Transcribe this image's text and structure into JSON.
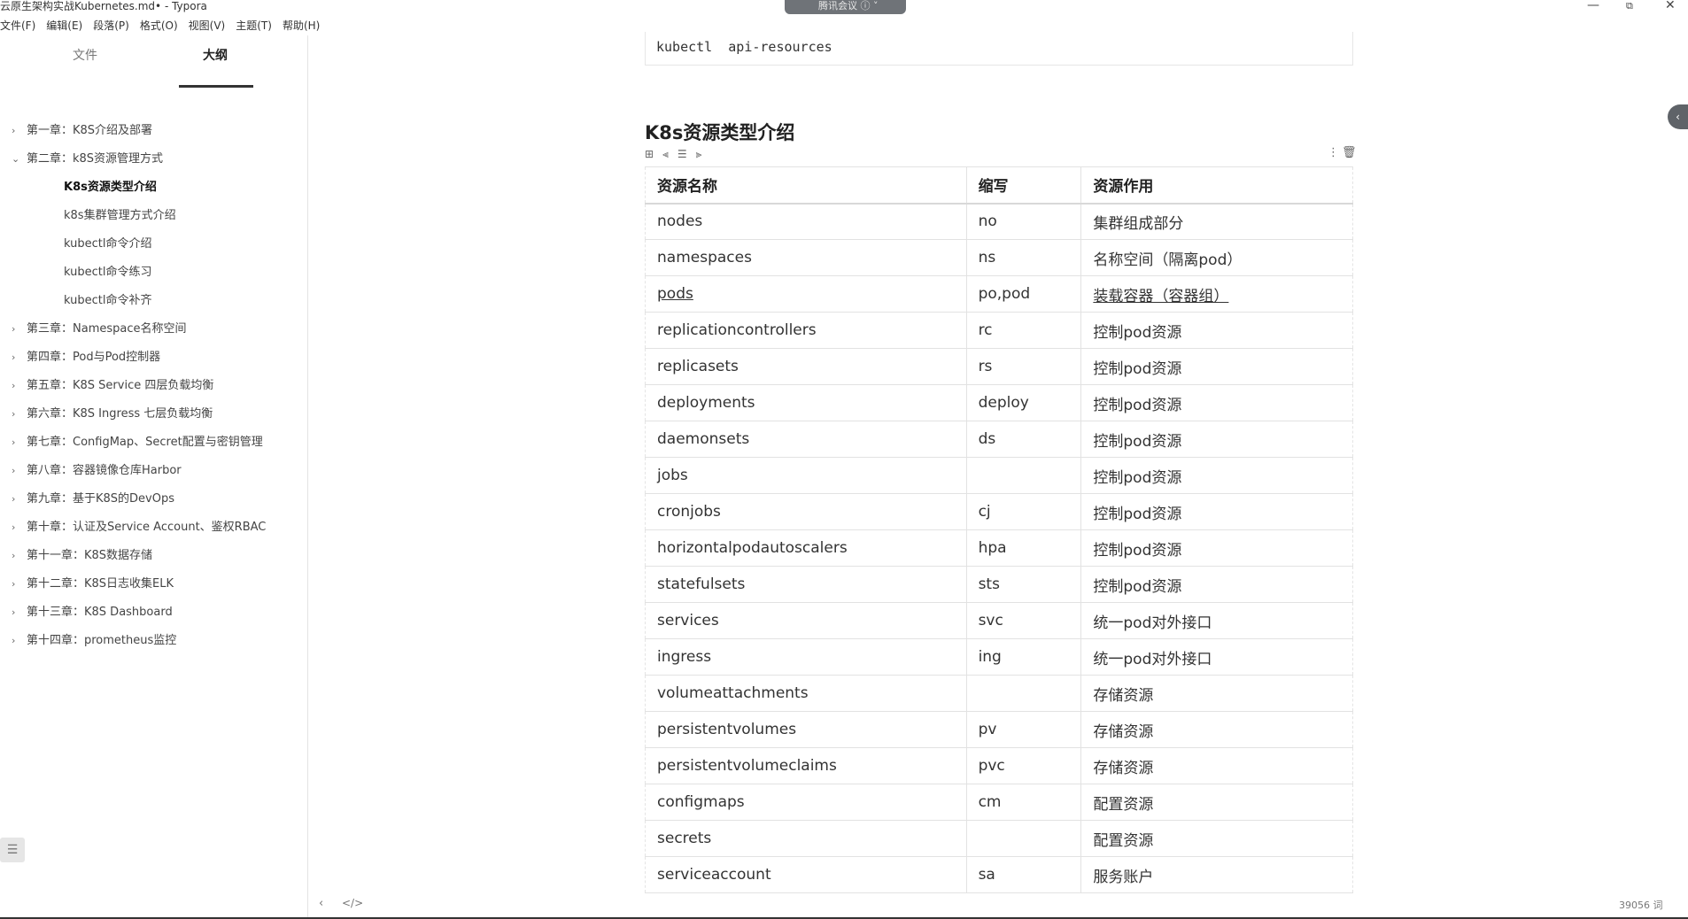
{
  "window": {
    "title": "云原生架构实战Kubernetes.md• - Typora",
    "meeting_label": "腾讯会议 ⓘ ˅",
    "minimize": "—",
    "maximize": "⧉",
    "close": "✕"
  },
  "menu": [
    "文件(F)",
    "编辑(E)",
    "段落(P)",
    "格式(O)",
    "视图(V)",
    "主题(T)",
    "帮助(H)"
  ],
  "sidebar": {
    "tabs": {
      "files": "文件",
      "outline": "大纲"
    },
    "outline": [
      {
        "label": "第一章：K8S介绍及部署",
        "chev": "›"
      },
      {
        "label": "第二章：k8S资源管理方式",
        "chev": "⌄"
      },
      {
        "label": "K8s资源类型介绍",
        "chev": ""
      },
      {
        "label": "k8s集群管理方式介绍",
        "chev": ""
      },
      {
        "label": "kubectl命令介绍",
        "chev": ""
      },
      {
        "label": "kubectl命令练习",
        "chev": ""
      },
      {
        "label": "kubectl命令补齐",
        "chev": ""
      },
      {
        "label": "第三章：Namespace名称空间",
        "chev": "›"
      },
      {
        "label": "第四章：Pod与Pod控制器",
        "chev": "›"
      },
      {
        "label": "第五章：K8S Service 四层负载均衡",
        "chev": "›"
      },
      {
        "label": "第六章：K8S Ingress 七层负载均衡",
        "chev": "›"
      },
      {
        "label": "第七章：ConfigMap、Secret配置与密钥管理",
        "chev": "›"
      },
      {
        "label": "第八章：容器镜像仓库Harbor",
        "chev": "›"
      },
      {
        "label": "第九章：基于K8S的DevOps",
        "chev": "›"
      },
      {
        "label": "第十章：认证及Service Account、鉴权RBAC",
        "chev": "›"
      },
      {
        "label": "第十一章：K8S数据存储",
        "chev": "›"
      },
      {
        "label": "第十二章：K8S日志收集ELK",
        "chev": "›"
      },
      {
        "label": "第十三章：K8S Dashboard",
        "chev": "›"
      },
      {
        "label": "第十四章：prometheus监控",
        "chev": "›"
      }
    ],
    "toggle_icon": "☰"
  },
  "doc": {
    "code": "kubectl  api-resources",
    "heading": "K8s资源类型介绍",
    "table_tools": [
      "⊞",
      "⫷",
      "☰",
      "⫸"
    ],
    "table_more": "⋮",
    "table_delete": "🗑",
    "table": {
      "headers": [
        "资源名称",
        "缩写",
        "资源作用"
      ],
      "rows": [
        [
          "nodes",
          "no",
          "集群组成部分"
        ],
        [
          "namespaces",
          "ns",
          "名称空间（隔离pod）"
        ],
        [
          "pods",
          "po,pod",
          "装载容器（容器组）"
        ],
        [
          "replicationcontrollers",
          "rc",
          "控制pod资源"
        ],
        [
          "replicasets",
          "rs",
          "控制pod资源"
        ],
        [
          "deployments",
          "deploy",
          "控制pod资源"
        ],
        [
          "daemonsets",
          "ds",
          "控制pod资源"
        ],
        [
          "jobs",
          "",
          "控制pod资源"
        ],
        [
          "cronjobs",
          "cj",
          "控制pod资源"
        ],
        [
          "horizontalpodautoscalers",
          "hpa",
          "控制pod资源"
        ],
        [
          "statefulsets",
          "sts",
          "控制pod资源"
        ],
        [
          "services",
          "svc",
          "统一pod对外接口"
        ],
        [
          "ingress",
          "ing",
          "统一pod对外接口"
        ],
        [
          "volumeattachments",
          "",
          "存储资源"
        ],
        [
          "persistentvolumes",
          "pv",
          "存储资源"
        ],
        [
          "persistentvolumeclaims",
          "pvc",
          "存储资源"
        ],
        [
          "configmaps",
          "cm",
          "配置资源"
        ],
        [
          "secrets",
          "",
          "配置资源"
        ],
        [
          "serviceaccount",
          "sa",
          "服务账户"
        ]
      ]
    }
  },
  "footer": {
    "back_icon": "‹",
    "source_icon": "</>",
    "word_count": "39056 词"
  },
  "edge_tab_icon": "‹"
}
